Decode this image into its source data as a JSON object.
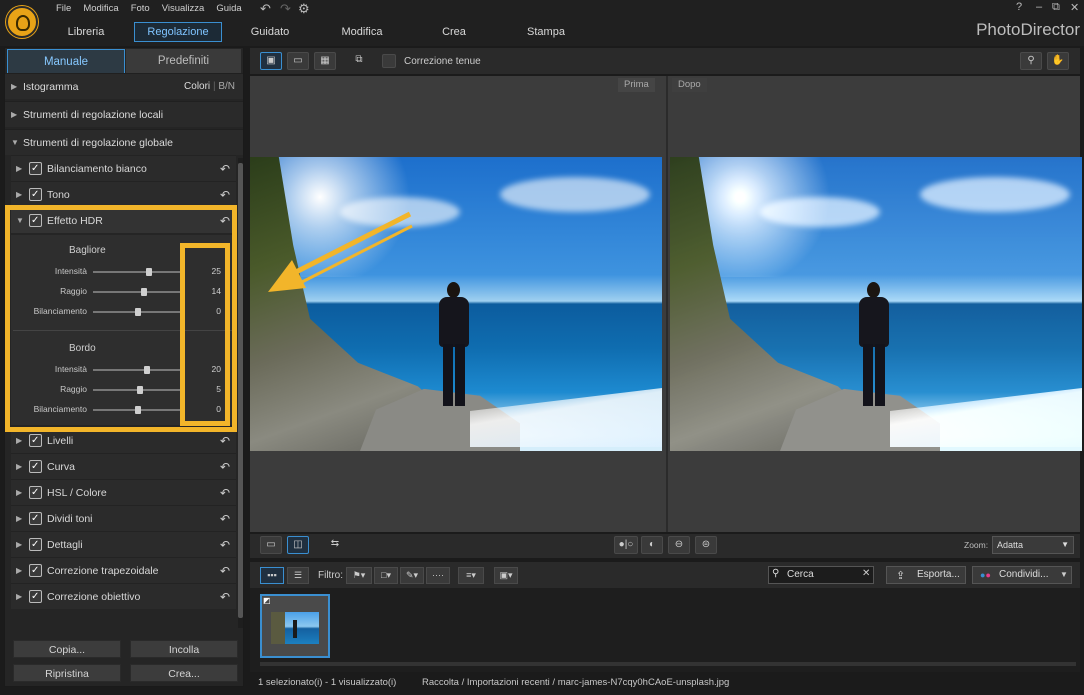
{
  "menu": [
    "File",
    "Modifica",
    "Foto",
    "Visualizza",
    "Guida"
  ],
  "tabs": [
    "Libreria",
    "Regolazione",
    "Guidato",
    "Modifica",
    "Crea",
    "Stampa"
  ],
  "app_name": "PhotoDirector",
  "window_controls": [
    "?",
    "–",
    "⧉",
    "✕"
  ],
  "panel": {
    "tab_manual": "Manuale",
    "tab_presets": "Predefiniti",
    "histogram": "Istogramma",
    "hist_colors": "Colori",
    "hist_bw": "B/N",
    "local_tools": "Strumenti di regolazione locali",
    "global_tools": "Strumenti di regolazione globale",
    "tools_top": [
      "Bilanciamento bianco",
      "Tono",
      "Effetto HDR"
    ],
    "hdr": {
      "glow_title": "Bagliore",
      "edge_title": "Bordo",
      "glow": [
        {
          "label": "Intensità",
          "value": "25",
          "pos": 0.62
        },
        {
          "label": "Raggio",
          "value": "14",
          "pos": 0.57
        },
        {
          "label": "Bilanciamento",
          "value": "0",
          "pos": 0.5
        }
      ],
      "edge": [
        {
          "label": "Intensità",
          "value": "20",
          "pos": 0.6
        },
        {
          "label": "Raggio",
          "value": "5",
          "pos": 0.52
        },
        {
          "label": "Bilanciamento",
          "value": "0",
          "pos": 0.5
        }
      ]
    },
    "tools_bottom": [
      "Livelli",
      "Curva",
      "HSL / Colore",
      "Dividi toni",
      "Dettagli",
      "Correzione trapezoidale",
      "Correzione obiettivo"
    ],
    "btn_copy": "Copia...",
    "btn_paste": "Incolla",
    "btn_reset": "Ripristina",
    "btn_create": "Crea..."
  },
  "view": {
    "soft_correction": "Correzione tenue",
    "before": "Prima",
    "after": "Dopo",
    "zoom_label": "Zoom:",
    "zoom_value": "Adatta"
  },
  "filmbar": {
    "filter_label": "Filtro:",
    "search_placeholder": "Cerca",
    "export": "Esporta...",
    "share": "Condividi..."
  },
  "status": {
    "selection": "1 selezionato(i) - 1 visualizzato(i)",
    "path": "Raccolta / Importazioni recenti / marc-james-N7cqy0hCAoE-unsplash.jpg"
  },
  "colors": {
    "accent": "#3a8fd1",
    "highlight": "#f2b52a"
  }
}
